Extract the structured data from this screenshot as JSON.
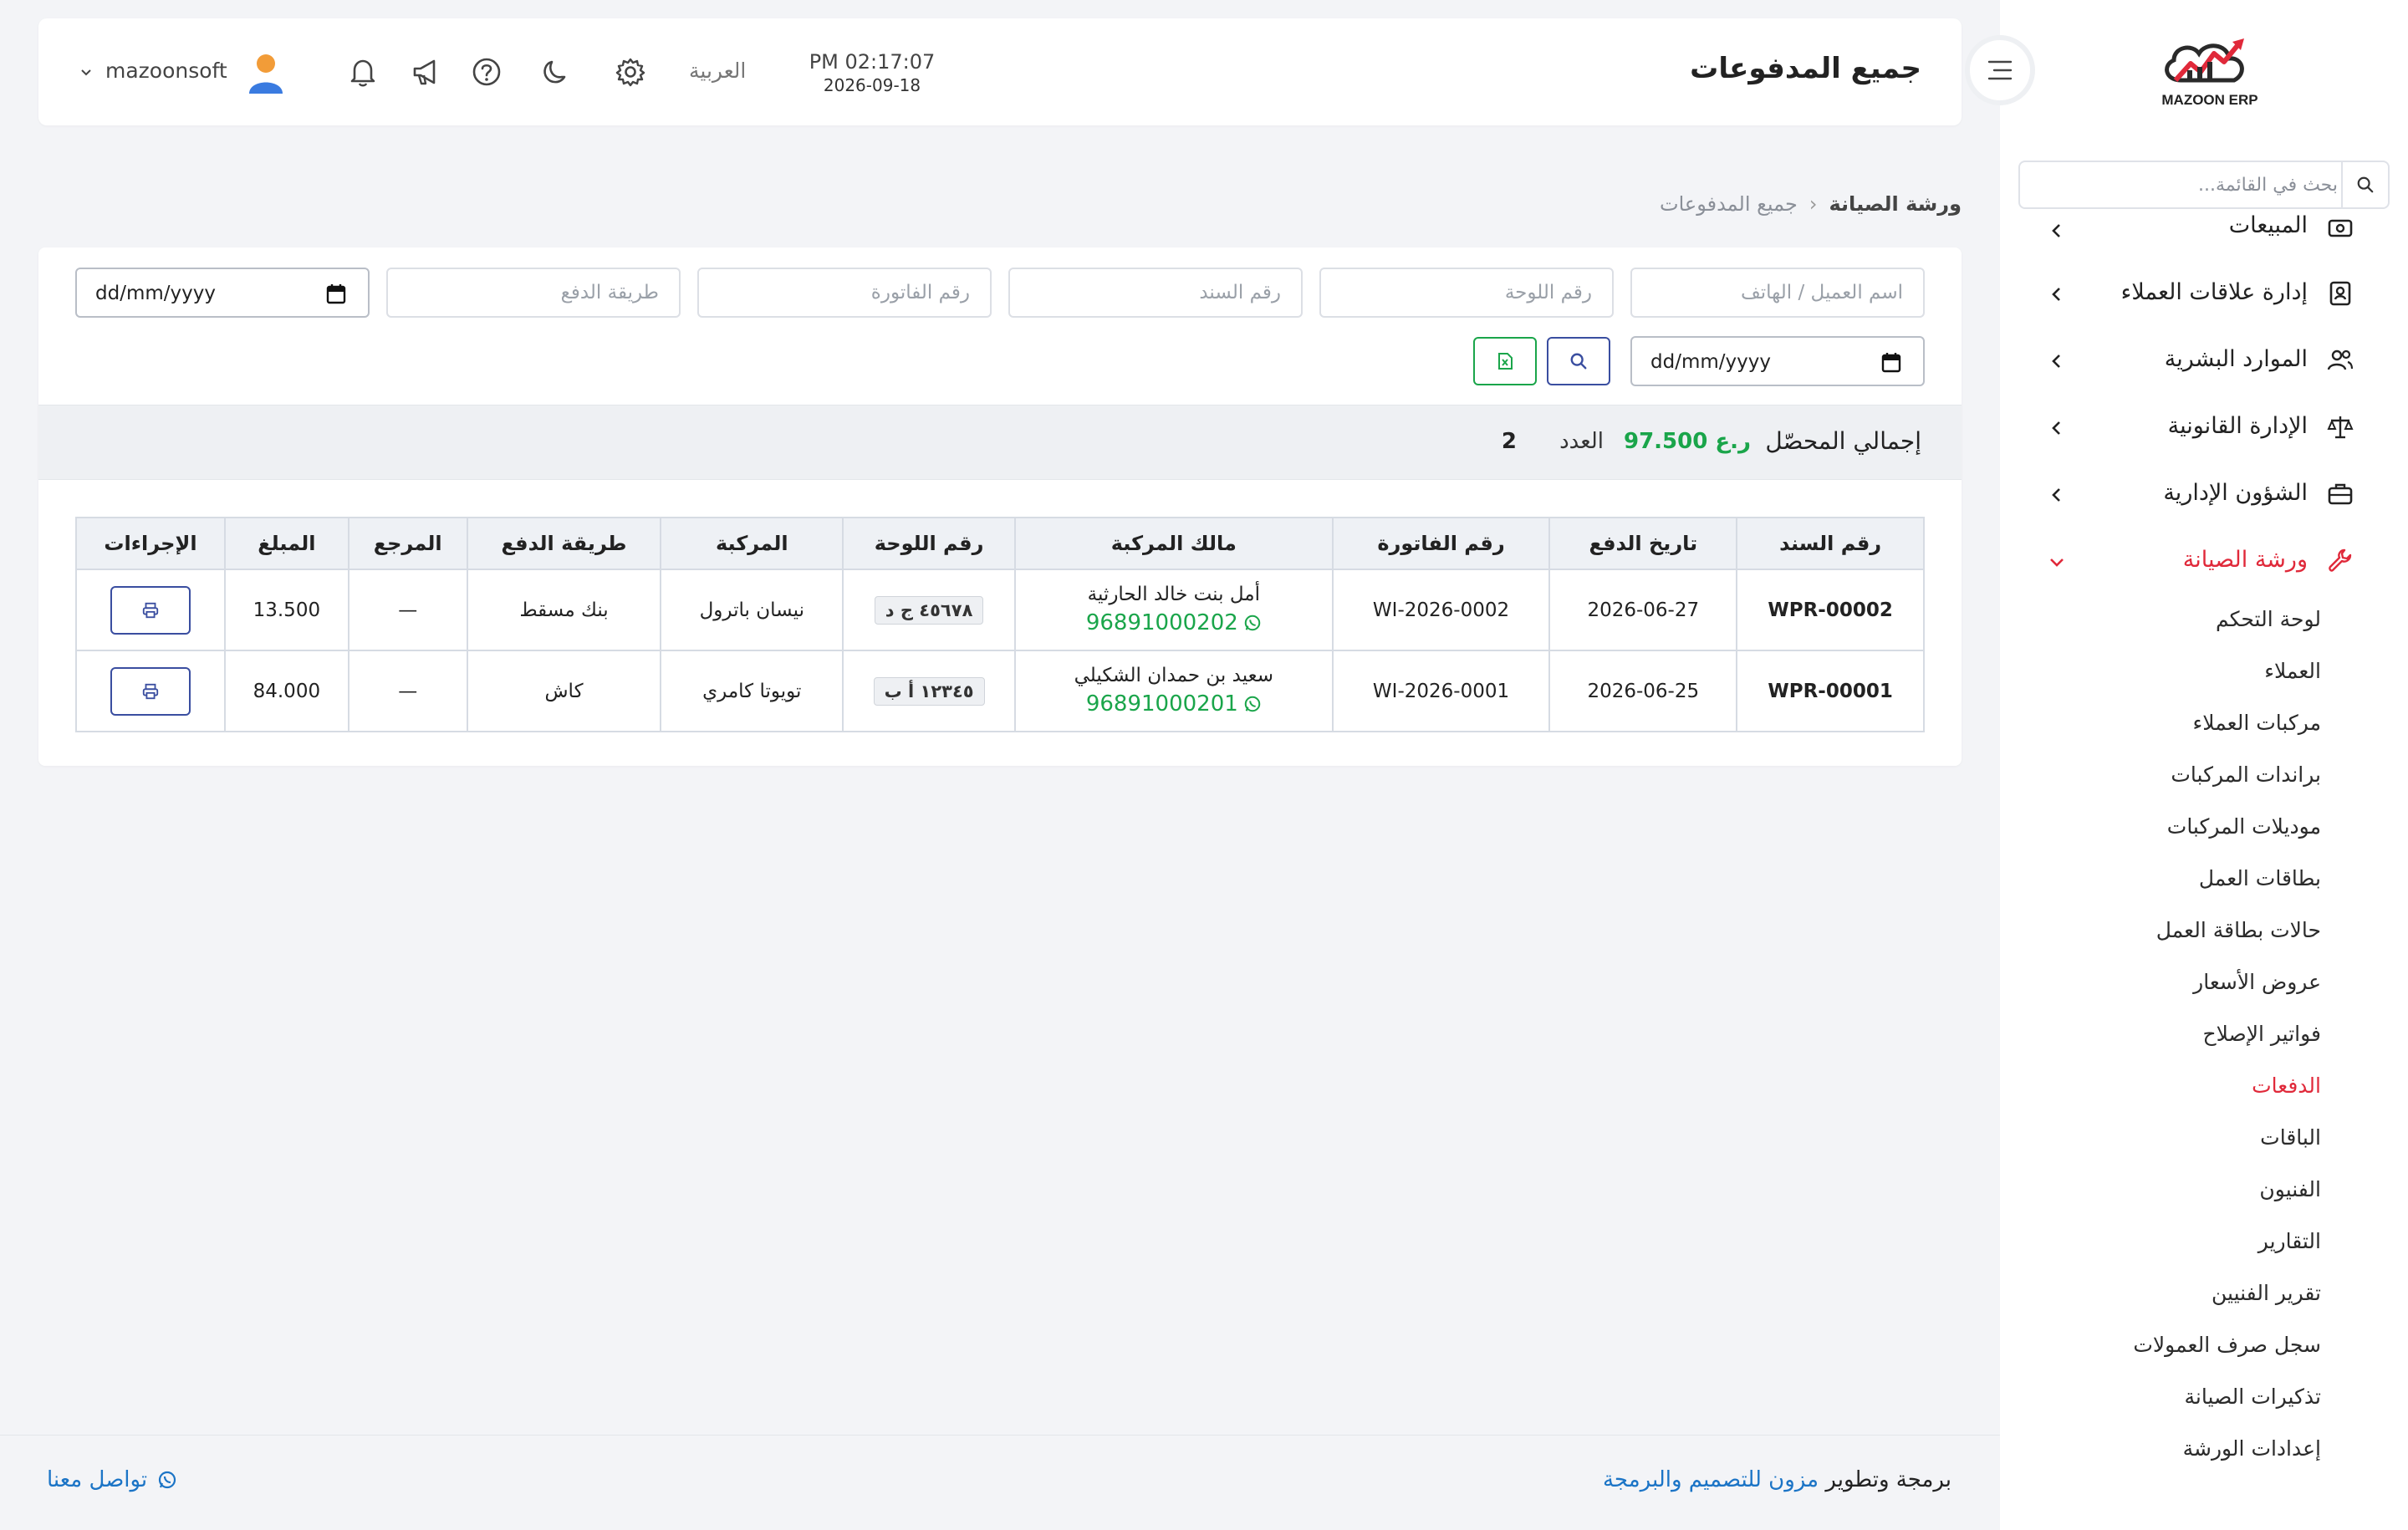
{
  "brand": {
    "logo_text": "MAZOON ERP"
  },
  "sidebar": {
    "search_placeholder": "بحث في القائمة...",
    "menu": [
      {
        "label": "المبيعات",
        "icon": "cash-register-icon"
      },
      {
        "label": "إدارة علاقات العملاء",
        "icon": "contact-card-icon"
      },
      {
        "label": "الموارد البشرية",
        "icon": "users-icon"
      },
      {
        "label": "الإدارة القانونية",
        "icon": "scale-icon"
      },
      {
        "label": "الشؤون الإدارية",
        "icon": "briefcase-icon"
      },
      {
        "label": "ورشة الصيانة",
        "icon": "wrench-icon",
        "active": true
      }
    ],
    "submenu": [
      "لوحة التحكم",
      "العملاء",
      "مركبات العملاء",
      "براندات المركبات",
      "موديلات المركبات",
      "بطاقات العمل",
      "حالات بطاقة العمل",
      "عروض الأسعار",
      "فواتير الإصلاح",
      "الدفعات",
      "الباقات",
      "الفنيون",
      "التقارير",
      "تقرير الفنيين",
      "سجل صرف العمولات",
      "تذكيرات الصيانة",
      "إعدادات الورشة"
    ],
    "active_submenu": "الدفعات"
  },
  "header": {
    "title": "جميع المدفوعات",
    "time": "PM 02:17:07",
    "date": "2026-09-18",
    "language": "العربية",
    "username": "mazoonsoft"
  },
  "breadcrumb": {
    "root": "ورشة الصيانة",
    "current": "جميع المدفوعات"
  },
  "filters": {
    "customer_placeholder": "اسم العميل / الهاتف",
    "plate_placeholder": "رقم اللوحة",
    "voucher_placeholder": "رقم السند",
    "invoice_placeholder": "رقم الفاتورة",
    "method_placeholder": "طريقة الدفع",
    "date_from": "dd/mm/yyyy",
    "date_to": "dd/mm/yyyy"
  },
  "summary": {
    "total_label": "إجمالي المحصّل",
    "total_value": "97.500 ر.ع",
    "count_label": "العدد",
    "count_value": "2"
  },
  "table": {
    "headers": [
      "رقم السند",
      "تاريخ الدفع",
      "رقم الفاتورة",
      "مالك المركبة",
      "رقم اللوحة",
      "المركبة",
      "طريقة الدفع",
      "المرجع",
      "المبلغ",
      "الإجراءات"
    ],
    "rows": [
      {
        "voucher": "WPR-00002",
        "date": "2026-06-27",
        "invoice": "WI-2026-0002",
        "owner": "أمل بنت خالد الحارثية",
        "phone": "96891000202",
        "plate": "٤٥٦٧٨ ج د",
        "vehicle": "نيسان باترول",
        "method": "بنك مسقط",
        "reference": "—",
        "amount": "13.500"
      },
      {
        "voucher": "WPR-00001",
        "date": "2026-06-25",
        "invoice": "WI-2026-0001",
        "owner": "سعيد بن حمدان الشكيلي",
        "phone": "96891000201",
        "plate": "١٢٣٤٥ أ ب",
        "vehicle": "تويوتا كامري",
        "method": "كاش",
        "reference": "—",
        "amount": "84.000"
      }
    ]
  },
  "footer": {
    "credit_prefix": "برمجة وتطوير",
    "credit_link": "مزون للتصميم والبرمجة",
    "contact": "تواصل معنا"
  },
  "colors": {
    "accent": "#e0293a",
    "link": "#1b74c6",
    "success": "#1aa54a"
  }
}
